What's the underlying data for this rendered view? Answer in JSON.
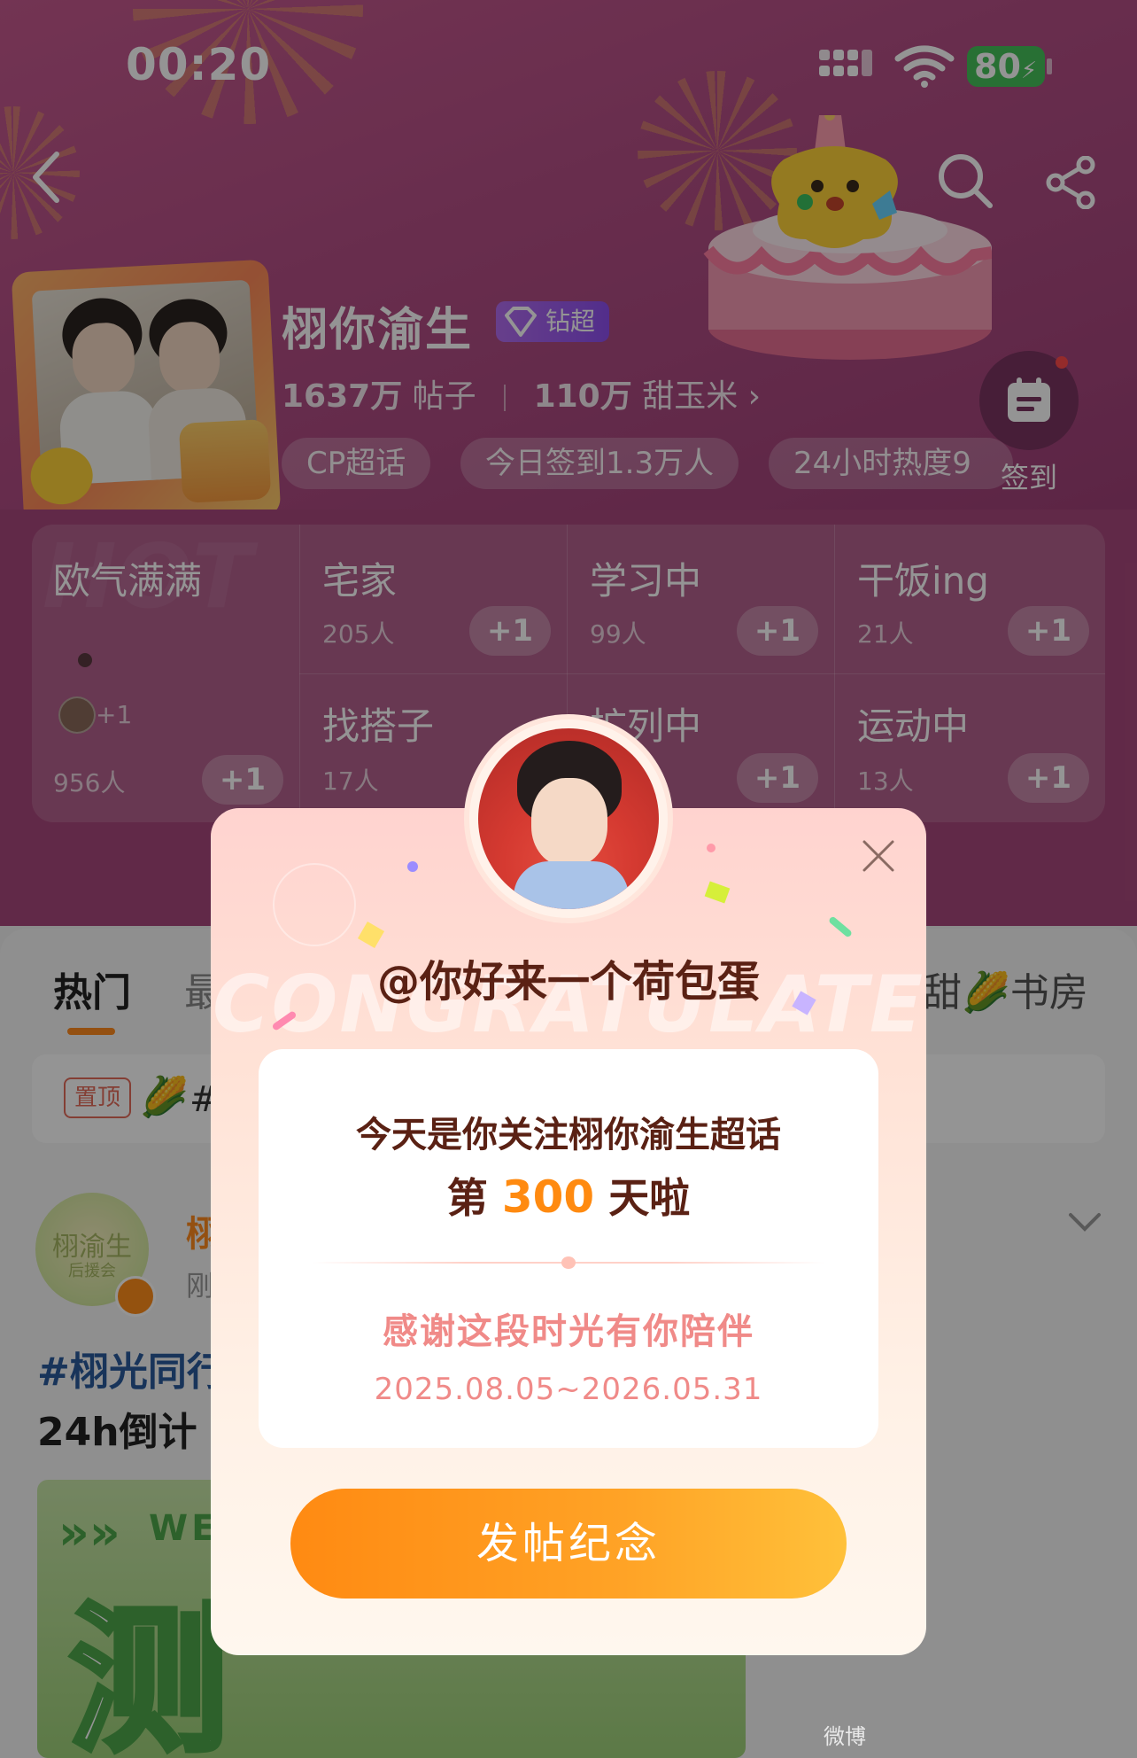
{
  "status_bar": {
    "time": "00:20",
    "battery": "80"
  },
  "topic": {
    "name": "栩你渝生",
    "tier": "钻超",
    "posts_count": "1637万",
    "posts_label": "帖子",
    "fans_count": "110万",
    "fans_label": "甜玉米",
    "chips": [
      "CP超话",
      "今日签到1.3万人",
      "24小时热度9"
    ],
    "checkin_label": "签到"
  },
  "mood_grid": {
    "featured": {
      "title": "欧气满满",
      "avatar_extra": "+1",
      "count": "956人",
      "plus": "+1"
    },
    "cells": [
      {
        "title": "宅家",
        "count": "205人",
        "plus": "+1"
      },
      {
        "title": "学习中",
        "count": "99人",
        "plus": "+1"
      },
      {
        "title": "干饭ing",
        "count": "21人",
        "plus": "+1"
      },
      {
        "title": "找搭子",
        "count": "17人",
        "plus": "+1"
      },
      {
        "title": "扩列中",
        "count": "",
        "plus": "+1"
      },
      {
        "title": "运动中",
        "count": "13人",
        "plus": "+1"
      }
    ]
  },
  "feed": {
    "tabs": [
      "热门",
      "最",
      "甜",
      "书房"
    ],
    "pinned_tag": "置顶",
    "pinned_hash": "#",
    "post": {
      "author_char": "栩",
      "time_char": "刚",
      "avatar_text": "栩渝生",
      "avatar_sub": "后援会",
      "line1": "#栩光同行",
      "line2": "24h倒计"
    },
    "image_text": "测",
    "image_word": "WE"
  },
  "modal": {
    "handle": "@你好来一个荷包蛋",
    "line1": "今天是你关注栩你渝生超话",
    "line2_prefix": "第",
    "days": "300",
    "line2_suffix": "天啦",
    "thanks": "感谢这段时光有你陪伴",
    "range": "2025.08.05~2026.05.31",
    "button": "发帖纪念",
    "bg_word": "CONGRATULATE"
  },
  "colors": {
    "accent_orange": "#ff8a12",
    "header_pink": "#b44f86",
    "modal_text": "#5a2114",
    "thanks_pink": "#f08a88"
  },
  "icons": [
    "back-icon",
    "search-icon",
    "share-icon",
    "calendar-icon",
    "diamond-icon",
    "close-icon",
    "chevron-down-icon",
    "wifi-icon",
    "signal-icon",
    "battery-icon",
    "corn-icon"
  ]
}
